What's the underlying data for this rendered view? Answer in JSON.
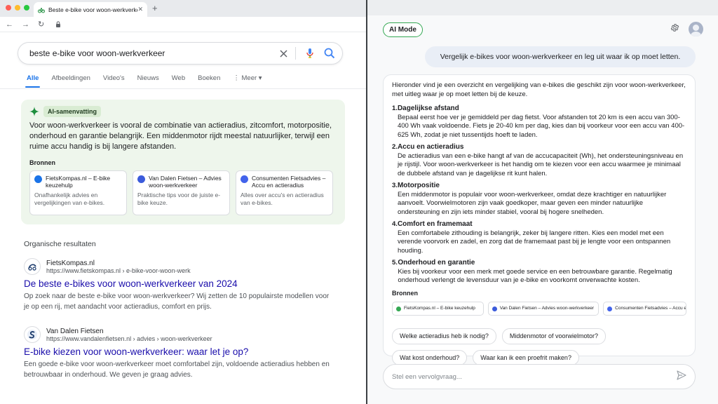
{
  "browser": {
    "tab_title": "Beste e-bike voor woon-werkverkeer",
    "tab_close": "✕",
    "new_tab": "+"
  },
  "search": {
    "query": "beste e-bike voor woon-werkverkeer",
    "tabs": [
      "Alle",
      "Afbeeldingen",
      "Video's",
      "Nieuws",
      "Web",
      "Boeken",
      "Meer"
    ]
  },
  "ai_summary": {
    "badge": "AI-samenvatting",
    "text": "Voor woon-werkverkeer is vooral de combinatie van actieradius, zitcomfort, motorpositie, onderhoud en garantie belangrijk. Een middenmotor rijdt meestal natuurlijker, terwijl een ruime accu handig is bij langere afstanden.",
    "sources_label": "Bronnen",
    "sources": [
      {
        "title": "FietsKompas.nl – E-bike keuzehulp",
        "desc": "Onafhankelijk advies en vergelijkingen van e-bikes.",
        "color": "#1a73e8"
      },
      {
        "title": "Van Dalen Fietsen – Advies woon-werkverkeer",
        "desc": "Praktische tips voor de juiste e-bike keuze.",
        "color": "#3b5bdb"
      },
      {
        "title": "Consumenten Fietsadvies – Accu en actieradius",
        "desc": "Alles over accu's en actieradius van e-bikes.",
        "color": "#4263eb"
      }
    ]
  },
  "organic": {
    "label": "Organische resultaten",
    "results": [
      {
        "site": "FietsKompas.nl",
        "url": "https://www.fietskompas.nl › e-bike-voor-woon-werk",
        "title": "De beste e-bikes voor woon-werkverkeer van 2024",
        "snippet": "Op zoek naar de beste e-bike voor woon-werkverkeer? Wij zetten de 10 populairste modellen voor je op een rij, met aandacht voor actieradius, comfort en prijs."
      },
      {
        "site": "Van Dalen Fietsen",
        "url": "https://www.vandalenfietsen.nl › advies › woon-werkverkeer",
        "title": "E-bike kiezen voor woon-werkverkeer: waar let je op?",
        "snippet": "Een goede e-bike voor woon-werkverkeer moet comfortabel zijn, voldoende actieradius hebben en betrouwbaar in onderhoud. We geven je graag advies."
      }
    ]
  },
  "ai_mode": {
    "label": "AI Mode",
    "user_message": "Vergelijk e-bikes voor woon-werkverkeer en leg uit waar ik op moet letten.",
    "intro": "Hieronder vind je een overzicht en vergelijking van e-bikes die geschikt zijn voor woon-werkverkeer, met uitleg waar je op moet letten bij de keuze.",
    "items": [
      {
        "num": "1.",
        "title": "Dagelijkse afstand",
        "text": "Bepaal eerst hoe ver je gemiddeld per dag fietst. Voor afstanden tot 20 km is een accu van 300-400 Wh vaak voldoende. Fiets je 20-40 km per dag, kies dan bij voorkeur voor een accu van 400-625 Wh, zodat je niet tussentijds hoeft te laden."
      },
      {
        "num": "2.",
        "title": "Accu en actieradius",
        "text": "De actieradius van een e-bike hangt af van de accucapaciteit (Wh), het ondersteuningsniveau en je rijstijl. Voor woon-werkverkeer is het handig om te kiezen voor een accu waarmee je minimaal de dubbele afstand van je dagelijkse rit kunt halen."
      },
      {
        "num": "3.",
        "title": "Motorpositie",
        "text": "Een middenmotor is populair voor woon-werkverkeer, omdat deze krachtiger en natuurlijker aanvoelt. Voorwielmotoren zijn vaak goedkoper, maar geven een minder natuurlijke ondersteuning en zijn iets minder stabiel, vooral bij hogere snelheden."
      },
      {
        "num": "4.",
        "title": "Comfort en framemaat",
        "text": "Een comfortabele zithouding is belangrijk, zeker bij langere ritten. Kies een model met een verende voorvork en zadel, en zorg dat de framemaat past bij je lengte voor een ontspannen houding."
      },
      {
        "num": "5.",
        "title": "Onderhoud en garantie",
        "text": "Kies bij voorkeur voor een merk met goede service en een betrouwbare garantie. Regelmatig onderhoud verlengt de levensduur van je e-bike en voorkomt onverwachte kosten."
      }
    ],
    "sources_label": "Bronnen",
    "chips": [
      {
        "label": "FietsKompas.nl – E-bike keuzehulp",
        "color": "#34a853"
      },
      {
        "label": "Van Dalen Fietsen – Advies woon-werkverkeer",
        "color": "#3b5bdb"
      },
      {
        "label": "Consumenten Fietsadvies – Accu en actieradius",
        "color": "#4263eb"
      }
    ],
    "suggestions": [
      [
        "Welke actieradius heb ik nodig?",
        "Middenmotor of voorwielmotor?"
      ],
      [
        "Wat kost onderhoud?",
        "Waar kan ik een proefrit maken?"
      ]
    ],
    "followup_placeholder": "Stel een vervolgvraag..."
  }
}
